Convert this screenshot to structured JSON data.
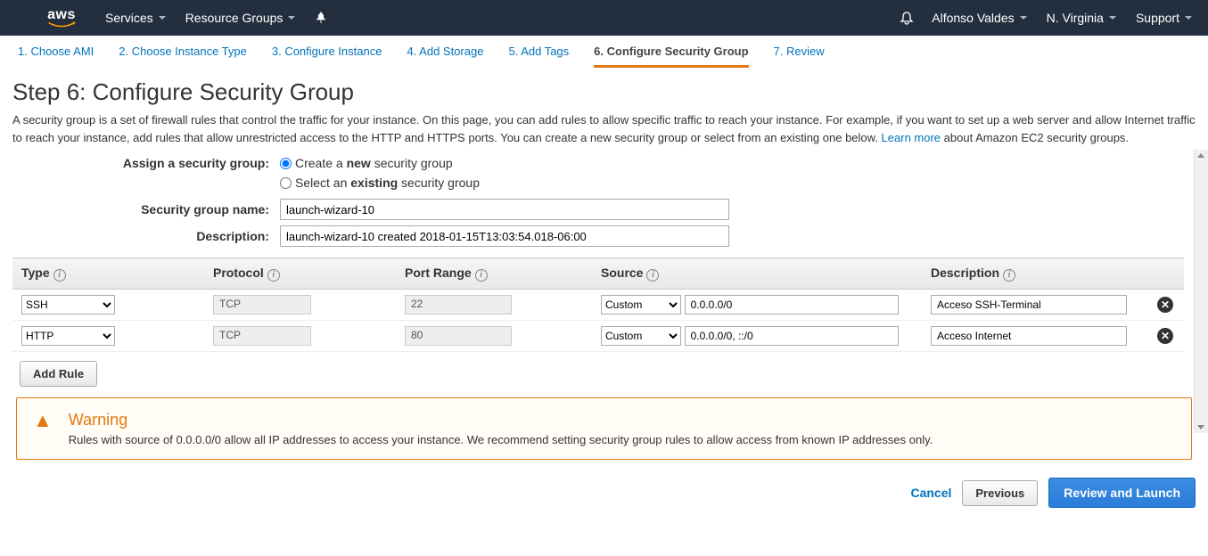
{
  "nav": {
    "services": "Services",
    "resource_groups": "Resource Groups",
    "user": "Alfonso Valdes",
    "region": "N. Virginia",
    "support": "Support"
  },
  "tabs": [
    "1. Choose AMI",
    "2. Choose Instance Type",
    "3. Configure Instance",
    "4. Add Storage",
    "5. Add Tags",
    "6. Configure Security Group",
    "7. Review"
  ],
  "heading": "Step 6: Configure Security Group",
  "description_1": "A security group is a set of firewall rules that control the traffic for your instance. On this page, you can add rules to allow specific traffic to reach your instance. For example, if you want to set up a web server and allow Internet traffic to reach your instance, add rules that allow unrestricted access to the HTTP and HTTPS ports. You can create a new security group or select from an existing one below. ",
  "learn_more": "Learn more",
  "description_2": " about Amazon EC2 security groups.",
  "labels": {
    "assign": "Assign a security group:",
    "create_pre": "Create a ",
    "create_bold": "new",
    "create_post": " security group",
    "select_pre": "Select an ",
    "select_bold": "existing",
    "select_post": " security group",
    "sg_name": "Security group name:",
    "sg_desc": "Description:"
  },
  "sg_name_value": "launch-wizard-10",
  "sg_desc_value": "launch-wizard-10 created 2018-01-15T13:03:54.018-06:00",
  "columns": {
    "type": "Type",
    "protocol": "Protocol",
    "port": "Port Range",
    "source": "Source",
    "description": "Description"
  },
  "rules": [
    {
      "type": "SSH",
      "protocol": "TCP",
      "port": "22",
      "source_mode": "Custom",
      "source": "0.0.0.0/0",
      "desc": "Acceso SSH-Terminal"
    },
    {
      "type": "HTTP",
      "protocol": "TCP",
      "port": "80",
      "source_mode": "Custom",
      "source": "0.0.0.0/0, ::/0",
      "desc": "Acceso Internet"
    }
  ],
  "add_rule": "Add Rule",
  "warning": {
    "title": "Warning",
    "text": "Rules with source of 0.0.0.0/0 allow all IP addresses to access your instance. We recommend setting security group rules to allow access from known IP addresses only."
  },
  "footer": {
    "cancel": "Cancel",
    "previous": "Previous",
    "review": "Review and Launch"
  }
}
